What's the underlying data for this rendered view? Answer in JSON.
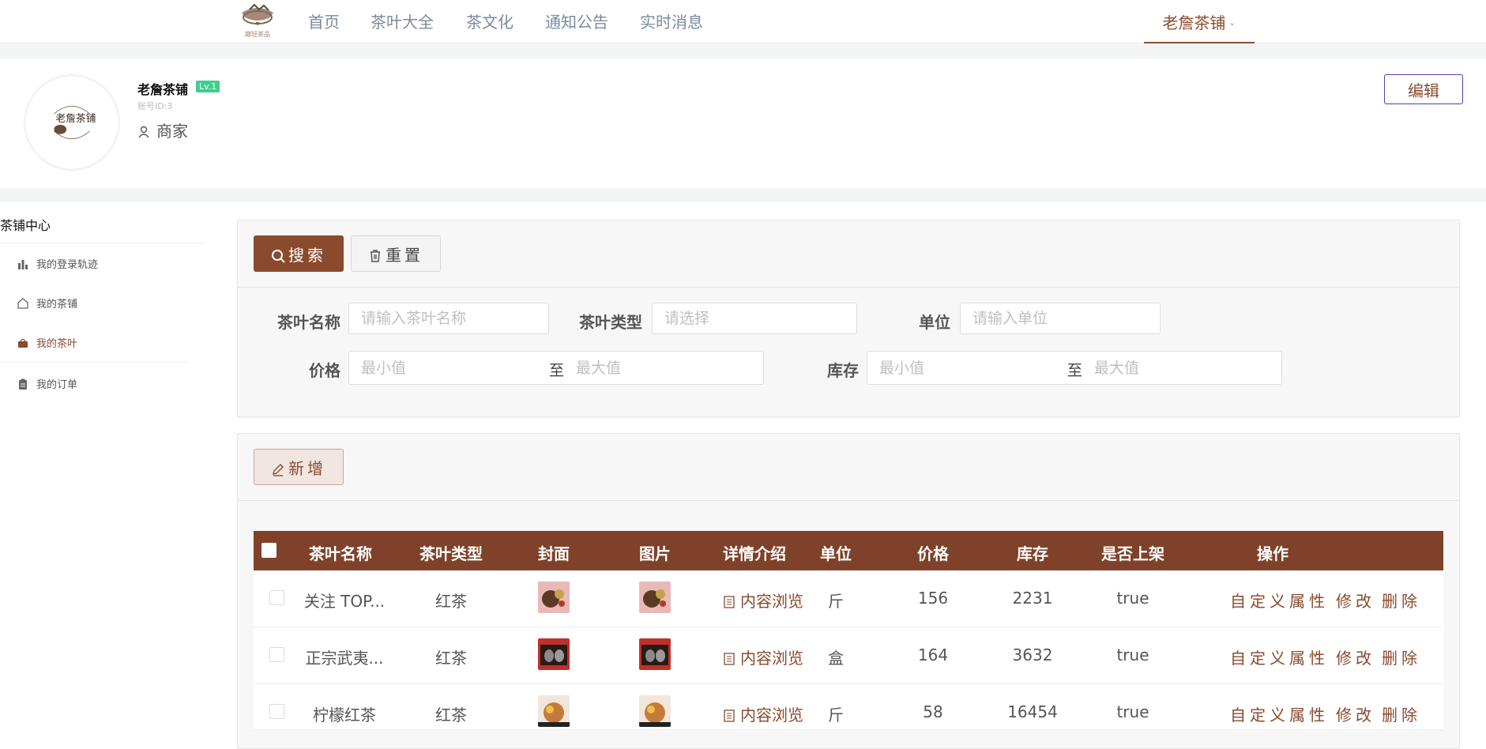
{
  "nav": {
    "logo_text": "趣轻茶品",
    "items": [
      {
        "label": "首页"
      },
      {
        "label": "茶叶大全"
      },
      {
        "label": "茶文化"
      },
      {
        "label": "通知公告"
      },
      {
        "label": "实时消息"
      }
    ],
    "user_name": "老詹茶铺"
  },
  "profile": {
    "avatar_text": "老詹茶铺",
    "shop_name": "老詹茶铺",
    "level": "Lv.1",
    "account_id": "账号ID:3",
    "role": "商家",
    "edit_label": "编辑"
  },
  "sidebar": {
    "title": "茶铺中心",
    "items": [
      {
        "label": "我的登录轨迹",
        "icon": "bar-chart-icon",
        "active": false
      },
      {
        "label": "我的茶铺",
        "icon": "home-icon",
        "active": false
      },
      {
        "label": "我的茶叶",
        "icon": "bag-icon",
        "active": true
      },
      {
        "label": "我的订单",
        "icon": "clipboard-icon",
        "active": false
      }
    ]
  },
  "search": {
    "search_label": "搜索",
    "reset_label": "重置",
    "fields": {
      "name_label": "茶叶名称",
      "name_placeholder": "请输入茶叶名称",
      "type_label": "茶叶类型",
      "type_placeholder": "请选择",
      "unit_label": "单位",
      "unit_placeholder": "请输入单位",
      "price_label": "价格",
      "stock_label": "库存",
      "min_placeholder": "最小值",
      "max_placeholder": "最大值",
      "range_sep": "至"
    }
  },
  "actions": {
    "add_label": "新增"
  },
  "table": {
    "headers": [
      "茶叶名称",
      "茶叶类型",
      "封面",
      "图片",
      "详情介绍",
      "单位",
      "价格",
      "库存",
      "是否上架",
      "操作"
    ],
    "detail_link": "内容浏览",
    "ops": {
      "attr": "自定义属性",
      "edit": "修改",
      "delete": "删除"
    },
    "rows": [
      {
        "name": "关注 TOP...",
        "type": "红茶",
        "unit": "斤",
        "price": "156",
        "stock": "2231",
        "on_sale": "true",
        "thumb": "mixed"
      },
      {
        "name": "正宗武夷...",
        "type": "红茶",
        "unit": "盒",
        "price": "164",
        "stock": "3632",
        "on_sale": "true",
        "thumb": "jars"
      },
      {
        "name": "柠檬红茶",
        "type": "红茶",
        "unit": "斤",
        "price": "58",
        "stock": "16454",
        "on_sale": "true",
        "thumb": "lemon"
      }
    ]
  },
  "colors": {
    "brand": "#8a4a2e",
    "table_header": "#7f412a",
    "level_badge": "#3ecf8e"
  }
}
